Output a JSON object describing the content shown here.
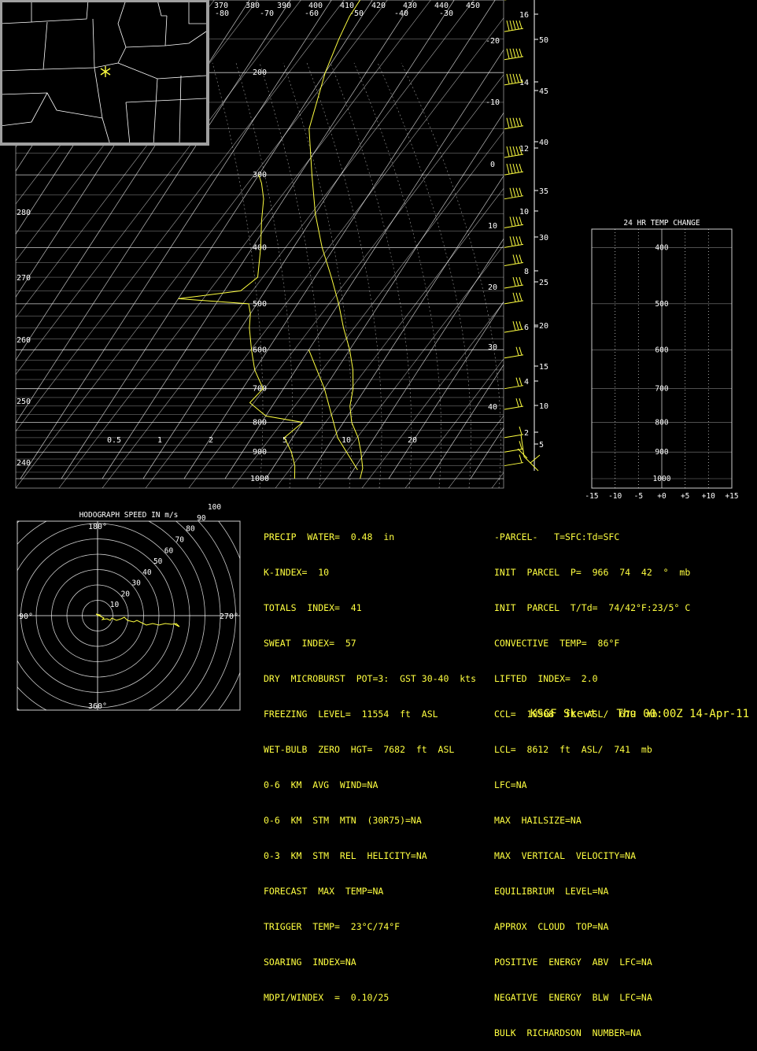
{
  "colors": {
    "background": "#000000",
    "grid": "#ffffff",
    "trace": "#ffff40",
    "map_frame": "#a0a0a0"
  },
  "map_inset": {
    "marker_icon": "asterisk-station-marker"
  },
  "chart_data": [
    {
      "type": "line",
      "name": "skewt",
      "pressure_levels": [
        200,
        300,
        400,
        500,
        600,
        700,
        800,
        900,
        1000
      ],
      "pressure_labels": [
        "200",
        "300",
        "400",
        "500",
        "600",
        "700",
        "800",
        "900",
        "1000"
      ],
      "isotherm_labels": [
        "-80",
        "-70",
        "-60",
        "-50",
        "-40",
        "-30",
        "-20",
        "-10",
        "0",
        "10",
        "20",
        "30",
        "40"
      ],
      "dry_adiabat_labels": [
        "370",
        "380",
        "390",
        "400",
        "410",
        "420",
        "430",
        "440",
        "450",
        "280",
        "270",
        "260",
        "250",
        "240"
      ],
      "mixing_ratio_labels": [
        "0.5",
        "1",
        "2",
        "5",
        "10",
        "20"
      ],
      "height_km_labels": [
        "16",
        "14",
        "12",
        "10",
        "8",
        "6",
        "4",
        "2"
      ],
      "height_kft_labels": [
        "50",
        "45",
        "40",
        "35",
        "30",
        "25",
        "20",
        "15",
        "10",
        "5"
      ],
      "temperature_profile": [
        [
          1000,
          13
        ],
        [
          960,
          12
        ],
        [
          900,
          9
        ],
        [
          850,
          6
        ],
        [
          800,
          2
        ],
        [
          750,
          -1
        ],
        [
          700,
          -3
        ],
        [
          650,
          -6
        ],
        [
          600,
          -10
        ],
        [
          550,
          -15
        ],
        [
          500,
          -20
        ],
        [
          450,
          -26
        ],
        [
          400,
          -33
        ],
        [
          350,
          -40
        ],
        [
          300,
          -47
        ],
        [
          250,
          -55
        ],
        [
          200,
          -60
        ],
        [
          175,
          -62
        ],
        [
          160,
          -63
        ],
        [
          150,
          -63
        ]
      ],
      "dewpoint_profile": [
        [
          1000,
          -3
        ],
        [
          950,
          -5
        ],
        [
          900,
          -8
        ],
        [
          850,
          -12
        ],
        [
          800,
          -10
        ],
        [
          780,
          -20
        ],
        [
          740,
          -26
        ],
        [
          700,
          -25
        ],
        [
          650,
          -30
        ],
        [
          600,
          -34
        ],
        [
          550,
          -38
        ],
        [
          520,
          -40
        ],
        [
          500,
          -42
        ],
        [
          490,
          -60
        ],
        [
          475,
          -46
        ],
        [
          450,
          -44
        ],
        [
          400,
          -48
        ],
        [
          360,
          -52
        ],
        [
          330,
          -55
        ],
        [
          310,
          -58
        ],
        [
          300,
          -60
        ]
      ],
      "parcel_path": [
        [
          966,
          11
        ],
        [
          850,
          1
        ],
        [
          700,
          -10
        ],
        [
          600,
          -20
        ]
      ],
      "wind_barbs": [
        [
          150,
          45
        ],
        [
          170,
          50
        ],
        [
          190,
          55
        ],
        [
          210,
          55
        ],
        [
          250,
          50
        ],
        [
          280,
          45
        ],
        [
          300,
          45
        ],
        [
          330,
          40
        ],
        [
          370,
          35
        ],
        [
          400,
          35
        ],
        [
          430,
          30
        ],
        [
          470,
          30
        ],
        [
          500,
          25
        ],
        [
          560,
          25
        ],
        [
          620,
          20
        ],
        [
          700,
          15
        ],
        [
          760,
          15
        ],
        [
          850,
          10
        ],
        [
          900,
          10
        ],
        [
          950,
          5
        ]
      ]
    },
    {
      "type": "line",
      "name": "temp_change",
      "title": "24 HR TEMP CHANGE",
      "x_ticks": [
        "-15",
        "-10",
        "-5",
        "+0",
        "+5",
        "+10",
        "+15"
      ],
      "y_labels": [
        "400",
        "500",
        "600",
        "700",
        "800",
        "900",
        "1000"
      ],
      "series": []
    },
    {
      "type": "scatter",
      "name": "hodograph",
      "title": "HODOGRAPH SPEED IN m/s",
      "ring_labels": [
        "10",
        "20",
        "30",
        "40",
        "50",
        "60",
        "70",
        "80",
        "90",
        "100"
      ],
      "direction_labels": [
        "180°",
        "90°",
        "270°",
        "360°"
      ],
      "points": [
        [
          0,
          0
        ],
        [
          3,
          1
        ],
        [
          -2,
          2
        ],
        [
          4,
          -1
        ],
        [
          8,
          -3
        ],
        [
          6,
          -5
        ],
        [
          12,
          -4
        ],
        [
          16,
          -6
        ],
        [
          18,
          -3
        ],
        [
          24,
          -6
        ],
        [
          30,
          -4
        ],
        [
          34,
          -2
        ],
        [
          38,
          -6
        ],
        [
          46,
          -8
        ],
        [
          50,
          -6
        ],
        [
          58,
          -10
        ],
        [
          62,
          -12
        ],
        [
          70,
          -10
        ],
        [
          78,
          -12
        ],
        [
          86,
          -10
        ],
        [
          94,
          -11
        ],
        [
          100,
          -10
        ],
        [
          104,
          -14
        ],
        [
          98,
          -11
        ]
      ]
    }
  ],
  "stats_left": [
    "PRECIP  WATER=  0.48  in",
    "K-INDEX=  10",
    "TOTALS  INDEX=  41",
    "SWEAT  INDEX=  57",
    "DRY  MICROBURST  POT=3:  GST 30-40  kts",
    "FREEZING  LEVEL=  11554  ft  ASL",
    "WET-BULB  ZERO  HGT=  7682  ft  ASL",
    "0-6  KM  AVG  WIND=NA",
    "0-6  KM  STM  MTN  (30R75)=NA",
    "0-3  KM  STM  REL  HELICITY=NA",
    "FORECAST  MAX  TEMP=NA",
    "TRIGGER  TEMP=  23°C/74°F",
    "SOARING  INDEX=NA",
    "MDPI/WINDEX  =  0.10/25"
  ],
  "stats_right": [
    "-PARCEL-   T=SFC:Td=SFC",
    "INIT  PARCEL  P=  966  74  42  °  mb",
    "INIT  PARCEL  T/Td=  74/42°F:23/5° C",
    "CONVECTIVE  TEMP=  86°F",
    "LIFTED  INDEX=  2.0",
    "CCL=  10908  ft  ASL/  679  mb",
    "LCL=  8612  ft  ASL/  741  mb",
    "LFC=NA",
    "MAX  HAILSIZE=NA",
    "MAX  VERTICAL  VELOCITY=NA",
    "EQUILIBRIUM  LEVEL=NA",
    "APPROX  CLOUD  TOP=NA",
    "POSITIVE  ENERGY  ABV  LFC=NA",
    "NEGATIVE  ENERGY  BLW  LFC=NA",
    "BULK  RICHARDSON  NUMBER=NA"
  ],
  "footer": "KSGF Skewt   Thu 00:00Z 14-Apr-11"
}
